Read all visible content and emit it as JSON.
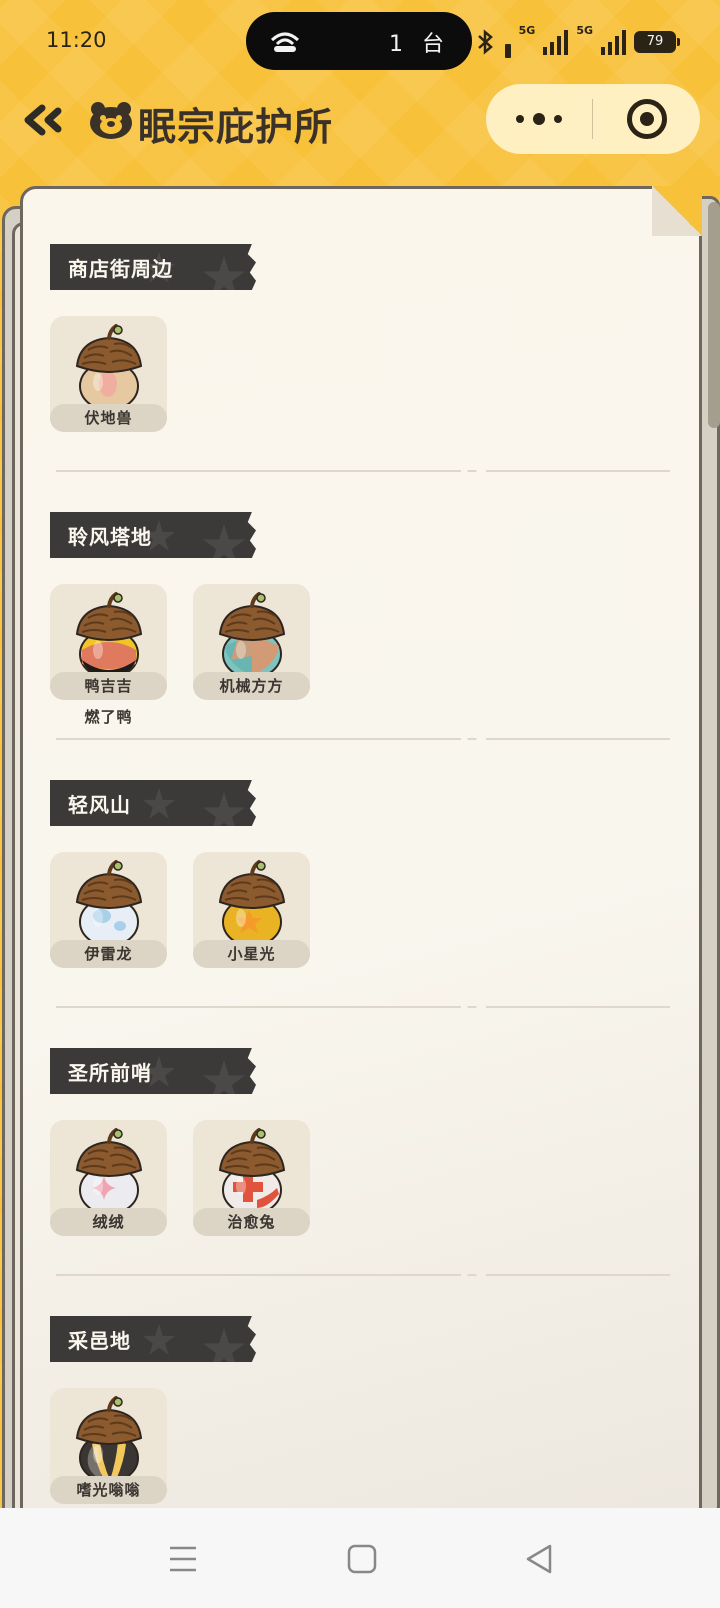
{
  "status_bar": {
    "time": "11:20",
    "island_count": "1 台",
    "signal1_label": "5G",
    "signal2_label": "5G",
    "battery": "79"
  },
  "nav": {
    "title": "眠宗庇护所",
    "back_icon": "double-chevron-left-icon",
    "logo_icon": "bear-logo-icon",
    "more_icon": "more-dots-icon",
    "close_icon": "target-ring-icon"
  },
  "sections": [
    {
      "title": "商店街周边",
      "items": [
        {
          "label": "伏地兽",
          "sub": "",
          "acorn": "tan"
        }
      ]
    },
    {
      "title": "聆风塔地",
      "items": [
        {
          "label": "鸭吉吉",
          "sub": "燃了鸭",
          "acorn": "yellow-black"
        },
        {
          "label": "机械方方",
          "sub": "",
          "acorn": "teal-check"
        }
      ]
    },
    {
      "title": "轻风山",
      "items": [
        {
          "label": "伊雷龙",
          "sub": "",
          "acorn": "ice"
        },
        {
          "label": "小星光",
          "sub": "",
          "acorn": "gold-star"
        }
      ]
    },
    {
      "title": "圣所前哨",
      "items": [
        {
          "label": "绒绒",
          "sub": "",
          "acorn": "pink-sparkle"
        },
        {
          "label": "治愈兔",
          "sub": "",
          "acorn": "red-cross"
        }
      ]
    },
    {
      "title": "采邑地",
      "items": [
        {
          "label": "嗜光嗡嗡",
          "sub": "",
          "acorn": "black-stripe"
        }
      ]
    }
  ],
  "system_nav": {
    "menu_icon": "menu-lines-icon",
    "home_icon": "square-home-icon",
    "back_icon": "triangle-back-icon"
  },
  "colors": {
    "background": "#f8c13a",
    "paper": "#faf6ec",
    "header": "#3b3a39",
    "item_card": "#ede5d6"
  }
}
